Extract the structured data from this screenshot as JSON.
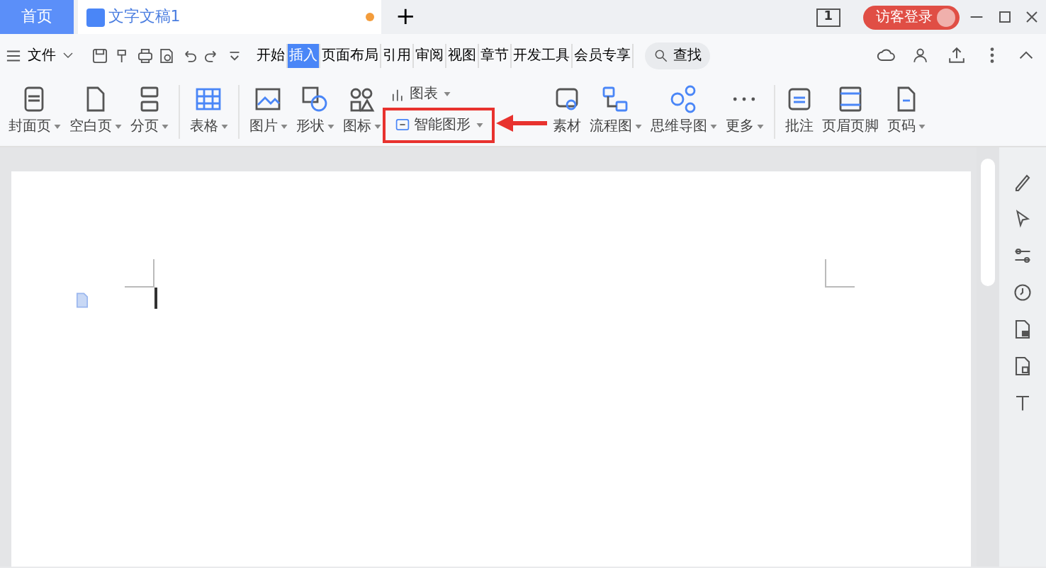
{
  "title_bar": {
    "home_tab": "首页",
    "doc_tab": {
      "title": "文字文稿1",
      "modified": true
    },
    "new_tab": "+",
    "window_count": "1",
    "login": "访客登录"
  },
  "menu": {
    "file": "文件",
    "tabs": [
      {
        "label": "开始",
        "selected": false
      },
      {
        "label": "插入",
        "selected": true
      },
      {
        "label": "页面布局",
        "selected": false
      },
      {
        "label": "引用",
        "selected": false
      },
      {
        "label": "审阅",
        "selected": false
      },
      {
        "label": "视图",
        "selected": false
      },
      {
        "label": "章节",
        "selected": false
      },
      {
        "label": "开发工具",
        "selected": false
      },
      {
        "label": "会员专享",
        "selected": false
      }
    ],
    "search": "查找"
  },
  "ribbon": [
    {
      "kind": "big",
      "label": "封面页",
      "dropdown": true
    },
    {
      "kind": "big",
      "label": "空白页",
      "dropdown": true
    },
    {
      "kind": "big",
      "label": "分页",
      "dropdown": true
    },
    {
      "kind": "sep"
    },
    {
      "kind": "big",
      "label": "表格",
      "dropdown": true
    },
    {
      "kind": "sep"
    },
    {
      "kind": "big",
      "label": "图片",
      "dropdown": true
    },
    {
      "kind": "big",
      "label": "形状",
      "dropdown": true
    },
    {
      "kind": "big",
      "label": "图标",
      "dropdown": true
    },
    {
      "kind": "stack",
      "items": [
        {
          "label": "图表",
          "dropdown": true,
          "highlighted": false
        },
        {
          "label": "智能图形",
          "dropdown": true,
          "highlighted": true
        }
      ]
    },
    {
      "kind": "big",
      "label": "素材",
      "dropdown": false
    },
    {
      "kind": "big",
      "label": "流程图",
      "dropdown": true
    },
    {
      "kind": "big",
      "label": "思维导图",
      "dropdown": true
    },
    {
      "kind": "big",
      "label": "更多",
      "dropdown": true
    },
    {
      "kind": "sep"
    },
    {
      "kind": "big",
      "label": "批注",
      "dropdown": false
    },
    {
      "kind": "big",
      "label": "页眉页脚",
      "dropdown": false
    },
    {
      "kind": "big",
      "label": "页码",
      "dropdown": true
    }
  ]
}
